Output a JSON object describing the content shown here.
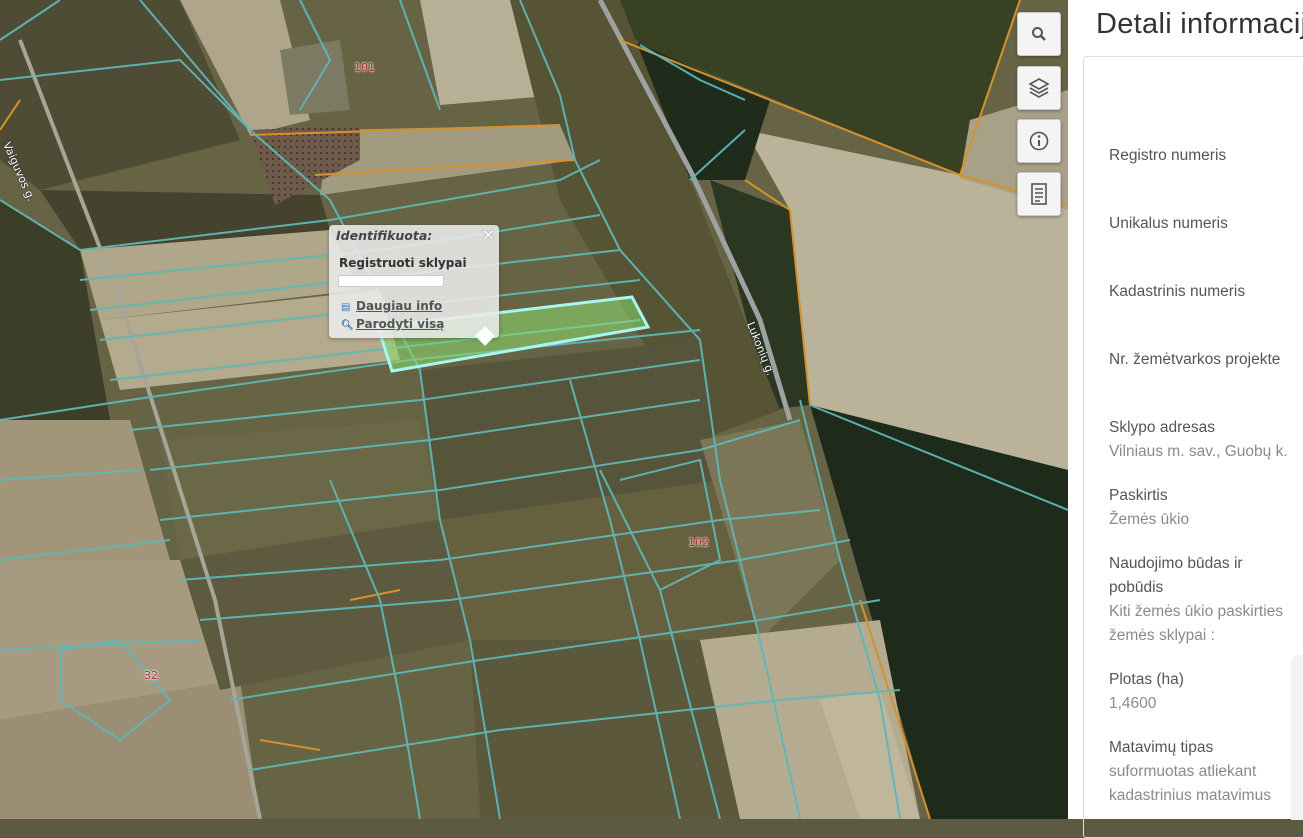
{
  "map": {
    "road_labels": [
      "Vaiguvos g.",
      "Lukonių g."
    ],
    "lot_numbers": [
      "101",
      "102",
      "32"
    ],
    "colors": {
      "parcel_border": "#5fb7b6",
      "orange_border": "#d6922a",
      "selected": "#7ff0ec"
    }
  },
  "toolbar": {
    "search_icon": "search-icon",
    "layers_icon": "layers-icon",
    "info_icon": "info-icon",
    "legend_icon": "document-icon"
  },
  "popup": {
    "title": "Identifikuota:",
    "close": "×",
    "layer_name": "Registruoti sklypai",
    "more_info": "Daugiau info",
    "show_all": "Parodyti visą"
  },
  "panel": {
    "title": "Detali informacija",
    "fields": [
      {
        "label": "Registro numeris",
        "value": ""
      },
      {
        "label": "Unikalus numeris",
        "value": ""
      },
      {
        "label": "Kadastrinis numeris",
        "value": ""
      },
      {
        "label": "Nr. žemėtvarkos projekte",
        "value": ""
      },
      {
        "label": "Sklypo adresas",
        "value": "Vilniaus m. sav., Guobų k."
      },
      {
        "label": "Paskirtis",
        "value": "Žemės ūkio"
      },
      {
        "label_line1": "Naudojimo būdas ir",
        "label_line2": "pobūdis",
        "value_line1": "Kiti žemės ūkio paskirties",
        "value_line2": "žemės sklypai :"
      },
      {
        "label": "Plotas (ha)",
        "value": "1,4600"
      },
      {
        "label": "Matavimų tipas",
        "value_line1": "suformuotas atliekant",
        "value_line2": "kadastrinius matavimus"
      }
    ]
  }
}
